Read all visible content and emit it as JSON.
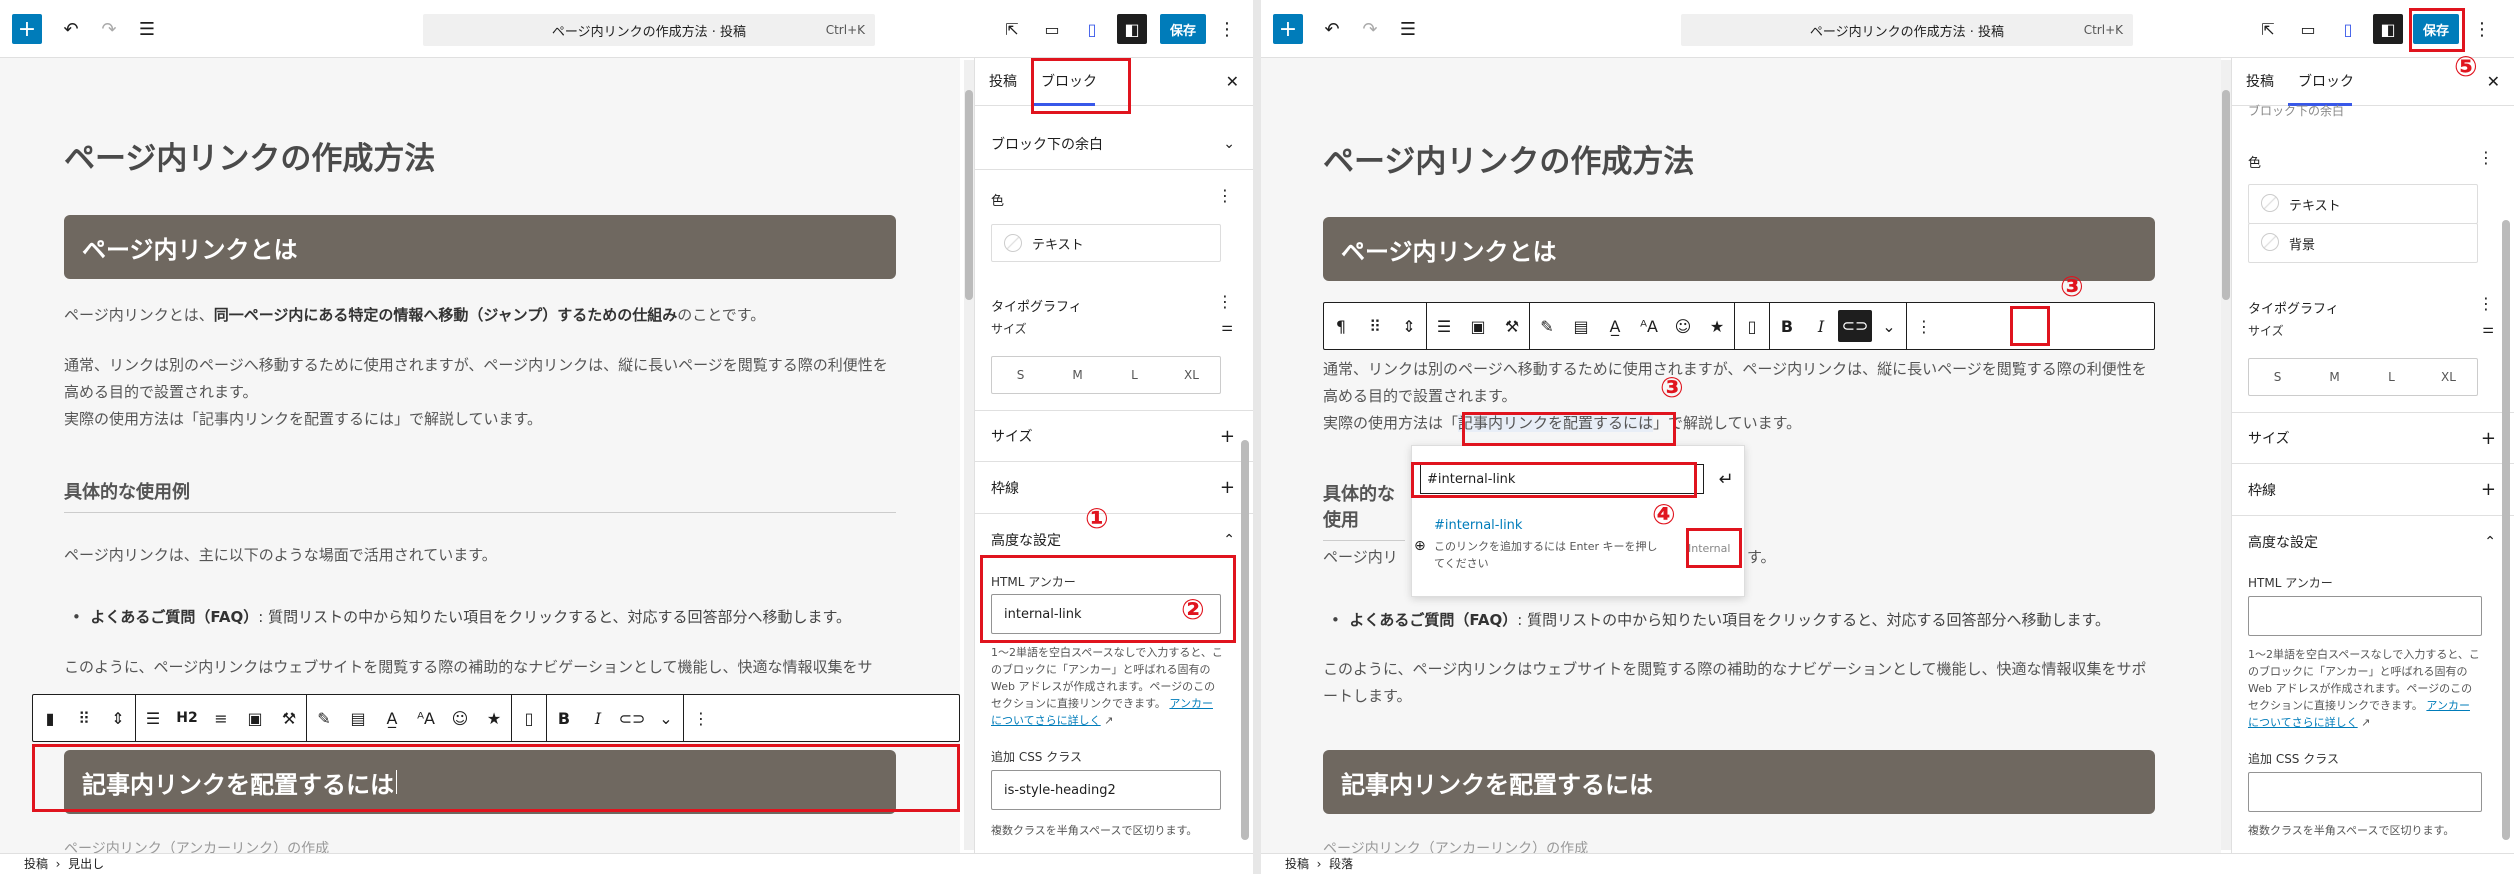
{
  "left": {
    "topbar": {
      "title": "ページ内リンクの作成方法 · 投稿",
      "shortcut": "Ctrl+K",
      "save": "保存"
    },
    "content": {
      "page_title": "ページ内リンクの作成方法",
      "heading1": "ページ内リンクとは",
      "p1_a": "ページ内リンクとは、",
      "p1_b": "同一ページ内にある特定の情報へ移動（ジャンプ）するための仕組み",
      "p1_c": "のことです。",
      "p2": "通常、リンクは別のページへ移動するために使用されますが、ページ内リンクは、縦に長いページを閲覧する際の利便性を高める目的で設置されます。",
      "p3": "実際の使用方法は「記事内リンクを配置するには」で解説しています。",
      "h3": "具体的な使用例",
      "p4": "ページ内リンクは、主に以下のような場面で活用されています。",
      "bullet_bold": "よくあるご質問（FAQ）",
      "bullet_rest": ": 質問リストの中から知りたい項目をクリックすると、対応する回答部分へ移動します。",
      "p5": "このように、ページ内リンクはウェブサイトを閲覧する際の補助的なナビゲーションとして機能し、快適な情報収集をサ",
      "heading2": "記事内リンクを配置するには",
      "cut_text": "ページ内リンク（アンカーリンク）の作成"
    },
    "sidebar": {
      "tab_post": "投稿",
      "tab_block": "ブロック",
      "row_margin": "ブロック下の余白",
      "color_label": "色",
      "color_text": "テキスト",
      "typo_label": "タイポグラフィ",
      "size_sub": "サイズ",
      "sizes": [
        "S",
        "M",
        "L",
        "XL"
      ],
      "row_size": "サイズ",
      "row_border": "枠線",
      "row_advanced": "高度な設定",
      "anchor_label": "HTML アンカー",
      "anchor_value": "internal-link",
      "anchor_help": "1〜2単語を空白スペースなしで入力すると、このブロックに「アンカー」と呼ばれる固有の Web アドレスが作成されます。ページのこのセクションに直接リンクできます。",
      "anchor_link": "アンカーについてさらに詳しく",
      "css_label": "追加 CSS クラス",
      "css_value": "is-style-heading2",
      "css_help": "複数クラスを半角スペースで区切ります。"
    },
    "statusbar": {
      "a": "投稿",
      "b": "見出し"
    },
    "toolbar_h2": "H2",
    "markers": [
      "①",
      "②"
    ]
  },
  "right": {
    "topbar": {
      "title": "ページ内リンクの作成方法 · 投稿",
      "shortcut": "Ctrl+K",
      "save": "保存"
    },
    "content": {
      "page_title": "ページ内リンクの作成方法",
      "heading1": "ページ内リンクとは",
      "p2": "通常、リンクは別のページへ移動するために使用されますが、ページ内リンクは、縦に長いページを閲覧する際の利便性を高める目的で設置されます。",
      "p3_a": "実際の使用方法は「",
      "p3_sel": "記事内リンクを配置するには",
      "p3_b": "」で解説しています。",
      "h3": "具体的な使用",
      "p4": "ページ内リ",
      "p4_tail": "す。",
      "bullet_bold": "よくあるご質問（FAQ）",
      "bullet_rest": ": 質問リストの中から知りたい項目をクリックすると、対応する回答部分へ移動します。",
      "p5": "このように、ページ内リンクはウェブサイトを閲覧する際の補助的なナビゲーションとして機能し、快適な情報収集をサポートします。",
      "heading2": "記事内リンクを配置するには",
      "cut_text": "ページ内リンク（アンカーリンク）の作成"
    },
    "popover": {
      "input": "#internal-link",
      "suggest": "#internal-link",
      "hint": "このリンクを追加するには Enter キーを押してください",
      "tag": "Internal"
    },
    "sidebar": {
      "tab_post": "投稿",
      "tab_block": "ブロック",
      "row_margin_cut": "ブロック下の余白",
      "color_label": "色",
      "color_text": "テキスト",
      "color_bg": "背景",
      "typo_label": "タイポグラフィ",
      "size_sub": "サイズ",
      "sizes": [
        "S",
        "M",
        "L",
        "XL"
      ],
      "row_size": "サイズ",
      "row_border": "枠線",
      "row_advanced": "高度な設定",
      "anchor_label": "HTML アンカー",
      "anchor_help": "1〜2単語を空白スペースなしで入力すると、このブロックに「アンカー」と呼ばれる固有の Web アドレスが作成されます。ページのこのセクションに直接リンクできます。",
      "anchor_link": "アンカーについてさらに詳しく",
      "css_label": "追加 CSS クラス",
      "css_help": "複数クラスを半角スペースで区切ります。"
    },
    "statusbar": {
      "a": "投稿",
      "b": "段落"
    },
    "markers": [
      "③",
      "③",
      "③",
      "④",
      "⑤"
    ]
  }
}
